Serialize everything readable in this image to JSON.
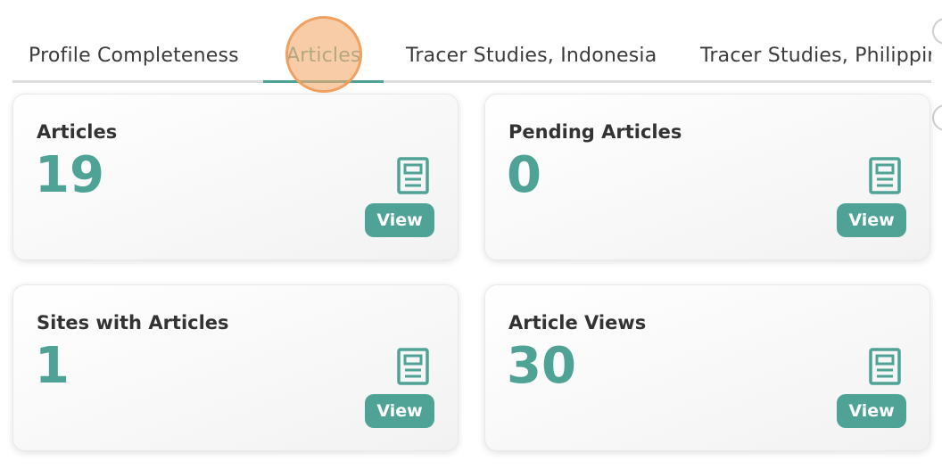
{
  "tabs": {
    "items": [
      {
        "label": "Profile Completeness"
      },
      {
        "label": "Articles"
      },
      {
        "label": "Tracer Studies, Indonesia"
      },
      {
        "label": "Tracer Studies, Philippines"
      }
    ],
    "active_index": 1
  },
  "cards": [
    {
      "title": "Articles",
      "value": "19",
      "button_label": "View",
      "icon": "document-icon"
    },
    {
      "title": "Pending Articles",
      "value": "0",
      "button_label": "View",
      "icon": "document-icon"
    },
    {
      "title": "Sites with Articles",
      "value": "1",
      "button_label": "View",
      "icon": "document-icon"
    },
    {
      "title": "Article Views",
      "value": "30",
      "button_label": "View",
      "icon": "document-icon"
    }
  ],
  "colors": {
    "accent": "#4fa396",
    "text": "#333333",
    "click_marker": "#f0a060"
  }
}
